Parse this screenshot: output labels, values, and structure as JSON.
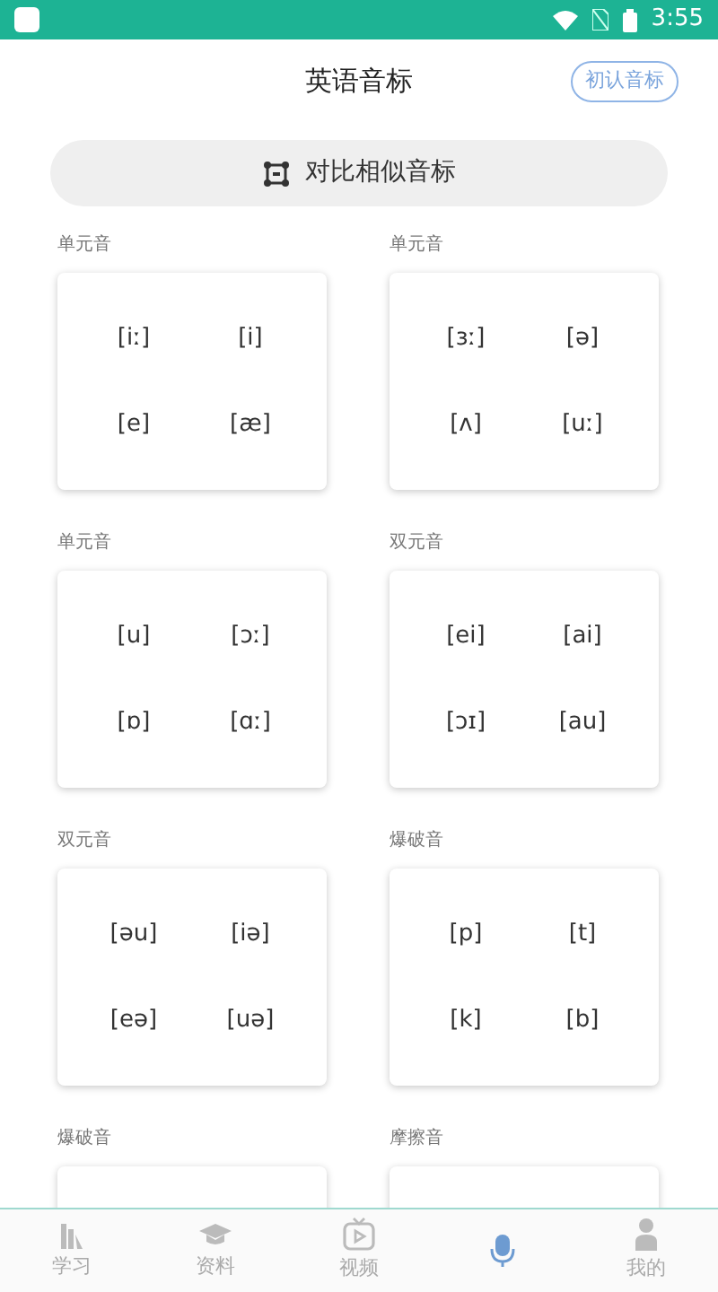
{
  "status_bar": {
    "time": "3:55"
  },
  "header": {
    "title": "英语音标",
    "action": "初认音标"
  },
  "compare_button": {
    "label": "对比相似音标"
  },
  "groups": [
    {
      "label": "单元音",
      "symbols": [
        "[iː]",
        "[i]",
        "[e]",
        "[æ]"
      ]
    },
    {
      "label": "单元音",
      "symbols": [
        "[ɜː]",
        "[ə]",
        "[ʌ]",
        "[uː]"
      ]
    },
    {
      "label": "单元音",
      "symbols": [
        "[u]",
        "[ɔː]",
        "[ɒ]",
        "[ɑː]"
      ]
    },
    {
      "label": "双元音",
      "symbols": [
        "[ei]",
        "[ai]",
        "[ɔɪ]",
        "[au]"
      ]
    },
    {
      "label": "双元音",
      "symbols": [
        "[əu]",
        "[iə]",
        "[eə]",
        "[uə]"
      ]
    },
    {
      "label": "爆破音",
      "symbols": [
        "[p]",
        "[t]",
        "[k]",
        "[b]"
      ]
    },
    {
      "label": "爆破音"
    },
    {
      "label": "摩擦音"
    }
  ],
  "tabs": [
    {
      "label": "学习",
      "kind": "study",
      "selected": false
    },
    {
      "label": "资料",
      "kind": "cap",
      "selected": false
    },
    {
      "label": "视频",
      "kind": "video",
      "selected": false
    },
    {
      "kind": "mic",
      "selected": true
    },
    {
      "label": "我的",
      "kind": "person",
      "selected": false
    }
  ]
}
